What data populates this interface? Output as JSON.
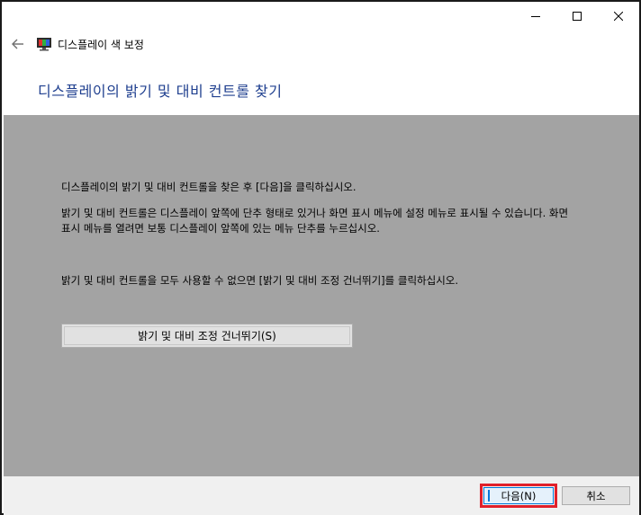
{
  "window": {
    "app_title": "디스플레이 색 보정",
    "page_title": "디스플레이의 밝기 및 대비 컨트롤 찾기"
  },
  "content": {
    "paragraph1": "디스플레이의 밝기 및 대비 컨트롤을 찾은 후 [다음]을 클릭하십시오.",
    "paragraph2": "밝기 및 대비 컨트롤은 디스플레이 앞쪽에 단추 형태로 있거나 화면 표시 메뉴에 설정 메뉴로 표시될 수 있습니다. 화면 표시 메뉴를 열려면 보통 디스플레이 앞쪽에 있는 메뉴 단추를 누르십시오.",
    "paragraph3": "밝기 및 대비 컨트롤을 모두 사용할 수 없으면 [밝기 및 대비 조정 건너뛰기]를 클릭하십시오.",
    "skip_button": "밝기 및 대비 조정 건너뛰기(S)"
  },
  "footer": {
    "next_button": "다음(N)",
    "cancel_button": "취소"
  },
  "colors": {
    "title_blue": "#1f3f8f",
    "content_gray": "#a3a3a3",
    "highlight_red": "#e0202a",
    "focus_blue": "#0078d7"
  },
  "icons": {
    "minimize": "minimize-icon",
    "maximize": "maximize-icon",
    "close": "close-icon",
    "back": "back-arrow-icon",
    "app": "display-color-calibration-icon"
  }
}
